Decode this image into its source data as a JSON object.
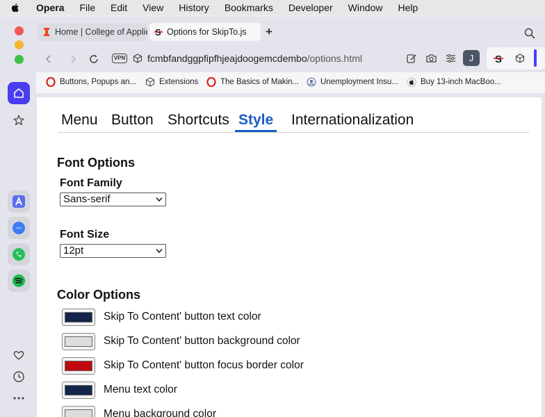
{
  "menubar": {
    "app": "Opera",
    "items": [
      "File",
      "Edit",
      "View",
      "History",
      "Bookmarks",
      "Developer",
      "Window",
      "Help"
    ]
  },
  "browser": {
    "tabs": [
      {
        "title": "Home | College of Applie",
        "active": false
      },
      {
        "title": "Options for SkipTo.js",
        "active": true
      }
    ],
    "new_tab": "+",
    "vpn_badge": "VPN",
    "url_host": "fcmbfandggpfipfhjeajdoogemcdembo",
    "url_path": "/options.html",
    "profile_initial": "J",
    "bookmarks": [
      {
        "label": "Buttons, Popups an...",
        "icon": "opera-icon"
      },
      {
        "label": "Extensions",
        "icon": "cube-icon"
      },
      {
        "label": "The Basics of Makin...",
        "icon": "opera-icon"
      },
      {
        "label": "Unemployment Insu...",
        "icon": "gov-seal-icon"
      },
      {
        "label": "Buy 13-inch MacBoo...",
        "icon": "apple-icon"
      }
    ]
  },
  "options": {
    "tabs": [
      "Menu",
      "Button",
      "Shortcuts",
      "Style",
      "Internationalization"
    ],
    "active_tab": "Style",
    "font_section": {
      "title": "Font Options",
      "family_label": "Font Family",
      "family_value": "Sans-serif",
      "size_label": "Font Size",
      "size_value": "12pt"
    },
    "color_section": {
      "title": "Color Options",
      "items": [
        {
          "label": "Skip To Content' button text color",
          "color": "#13254a"
        },
        {
          "label": "Skip To Content' button background color",
          "color": "#dddddd"
        },
        {
          "label": "Skip To Content' button focus border color",
          "color": "#c0090f"
        },
        {
          "label": "Menu text color",
          "color": "#13254a"
        },
        {
          "label": "Menu background color",
          "color": "#dddddd"
        }
      ]
    }
  },
  "colors": {
    "accent": "#1a5dc8",
    "sidebar_active": "#4a3df0"
  }
}
